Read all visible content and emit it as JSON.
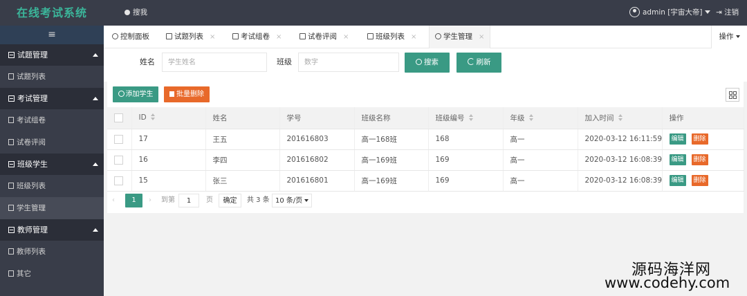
{
  "app": {
    "title": "在线考试系统"
  },
  "header": {
    "about": "搜我",
    "user": "admin [宇宙大帝]",
    "logout": "注销"
  },
  "sidebar": {
    "groups": [
      {
        "label": "试题管理",
        "items": [
          {
            "label": "试题列表"
          }
        ]
      },
      {
        "label": "考试管理",
        "items": [
          {
            "label": "考试组卷"
          },
          {
            "label": "试卷评阅"
          }
        ]
      },
      {
        "label": "班级学生",
        "items": [
          {
            "label": "班级列表"
          },
          {
            "label": "学生管理"
          }
        ]
      },
      {
        "label": "教师管理",
        "items": [
          {
            "label": "教师列表"
          }
        ]
      }
    ],
    "other": "其它"
  },
  "tabs": [
    {
      "label": "控制面板"
    },
    {
      "label": "试题列表"
    },
    {
      "label": "考试组卷"
    },
    {
      "label": "试卷评阅"
    },
    {
      "label": "班级列表"
    },
    {
      "label": "学生管理"
    }
  ],
  "tab_ops": "操作",
  "search": {
    "name_label": "姓名",
    "name_placeholder": "学生姓名",
    "class_label": "班级",
    "class_placeholder": "数字",
    "search_btn": "搜索",
    "refresh_btn": "刷新"
  },
  "toolbar": {
    "add": "添加学生",
    "batch_delete": "批量删除"
  },
  "table": {
    "headers": [
      "ID",
      "姓名",
      "学号",
      "班级名称",
      "班级编号",
      "年级",
      "加入时间",
      "操作"
    ],
    "rows": [
      {
        "id": "17",
        "name": "王五",
        "sno": "201616803",
        "cls": "高一168班",
        "cno": "168",
        "grade": "高一",
        "time": "2020-03-12 16:11:59"
      },
      {
        "id": "16",
        "name": "李四",
        "sno": "201616802",
        "cls": "高一169班",
        "cno": "169",
        "grade": "高一",
        "time": "2020-03-12 16:08:39"
      },
      {
        "id": "15",
        "name": "张三",
        "sno": "201616801",
        "cls": "高一169班",
        "cno": "169",
        "grade": "高一",
        "time": "2020-03-12 16:08:39"
      }
    ],
    "edit": "编辑",
    "delete": "删除"
  },
  "pager": {
    "current": "1",
    "goto": "到第",
    "page_value": "1",
    "page_unit": "页",
    "confirm": "确定",
    "total": "共 3 条",
    "size": "10 条/页"
  },
  "watermark": {
    "line1": "源码海洋网",
    "line2": "www.codehy.com"
  }
}
